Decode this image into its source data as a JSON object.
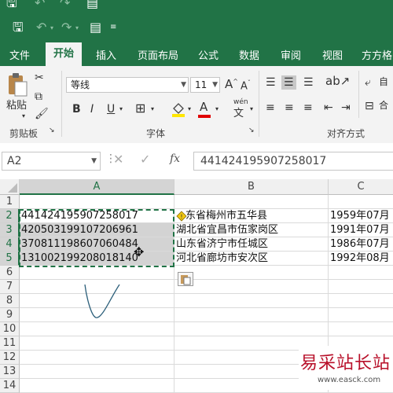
{
  "quick_access": {
    "save_icon": "save-icon",
    "undo_icon": "undo-icon",
    "redo_icon": "redo-icon",
    "form_icon": "form-icon",
    "customize_icon": "customize-qat-icon"
  },
  "tabs": [
    "文件",
    "开始",
    "插入",
    "页面布局",
    "公式",
    "数据",
    "审阅",
    "视图",
    "方方格"
  ],
  "ribbon": {
    "paste_label": "粘贴",
    "clipboard_label": "剪贴板",
    "font_name": "等线",
    "font_size": "11",
    "grow_font": "A",
    "shrink_font": "A",
    "bold": "B",
    "italic": "I",
    "underline": "U",
    "font_color_letter": "A",
    "phonetic": "wén",
    "font_label": "字体",
    "alignment_label": "对齐方式",
    "wrap_label": "自"
  },
  "formula_bar": {
    "name_box": "A2",
    "fx": "fx",
    "formula": "441424195907258017"
  },
  "grid": {
    "columns": [
      "A",
      "B",
      "C"
    ],
    "rows": [
      "1",
      "2",
      "3",
      "4",
      "5",
      "6",
      "7",
      "8",
      "9",
      "10",
      "11",
      "12",
      "13",
      "14"
    ],
    "cells": [
      {
        "a": "",
        "b": "",
        "c": ""
      },
      {
        "a": "441424195907258017",
        "b": "东省梅州市五华县",
        "c": "1959年07月"
      },
      {
        "a": "420503199107206961",
        "b": "湖北省宜昌市伍家岗区",
        "c": "1991年07月"
      },
      {
        "a": "370811198607060484",
        "b": "山东省济宁市任城区",
        "c": "1986年07月"
      },
      {
        "a": "131002199208018140",
        "b": "河北省廊坊市安次区",
        "c": "1992年08月"
      }
    ]
  },
  "colors": {
    "accent": "#217346",
    "shade": "#d3d3d3",
    "ink": "#2c5f7a"
  },
  "watermark": {
    "text": "易采站长站",
    "url": "www.easck.com"
  }
}
